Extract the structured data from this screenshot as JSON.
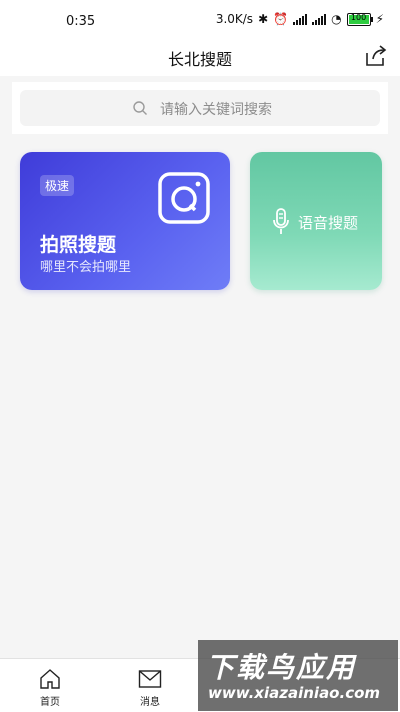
{
  "status_bar": {
    "time": "0:35",
    "network_speed": "3.0K/s",
    "battery": "100"
  },
  "header": {
    "title": "长北搜题",
    "share_icon": "share-icon"
  },
  "search": {
    "placeholder": "请输入关键词搜索",
    "icon": "search-icon"
  },
  "cards": {
    "photo": {
      "badge": "极速",
      "title": "拍照搜题",
      "subtitle": "哪里不会拍哪里",
      "icon": "camera-icon",
      "color": "#4a4fe6"
    },
    "voice": {
      "label": "语音搜题",
      "icon": "microphone-icon",
      "color": "#6fd0ab"
    }
  },
  "tab_bar": {
    "items": [
      {
        "label": "首页",
        "icon": "home-icon"
      },
      {
        "label": "消息",
        "icon": "mail-icon"
      }
    ]
  },
  "watermark": {
    "title": "下载鸟应用",
    "url": "www.xiazainiao.com"
  }
}
